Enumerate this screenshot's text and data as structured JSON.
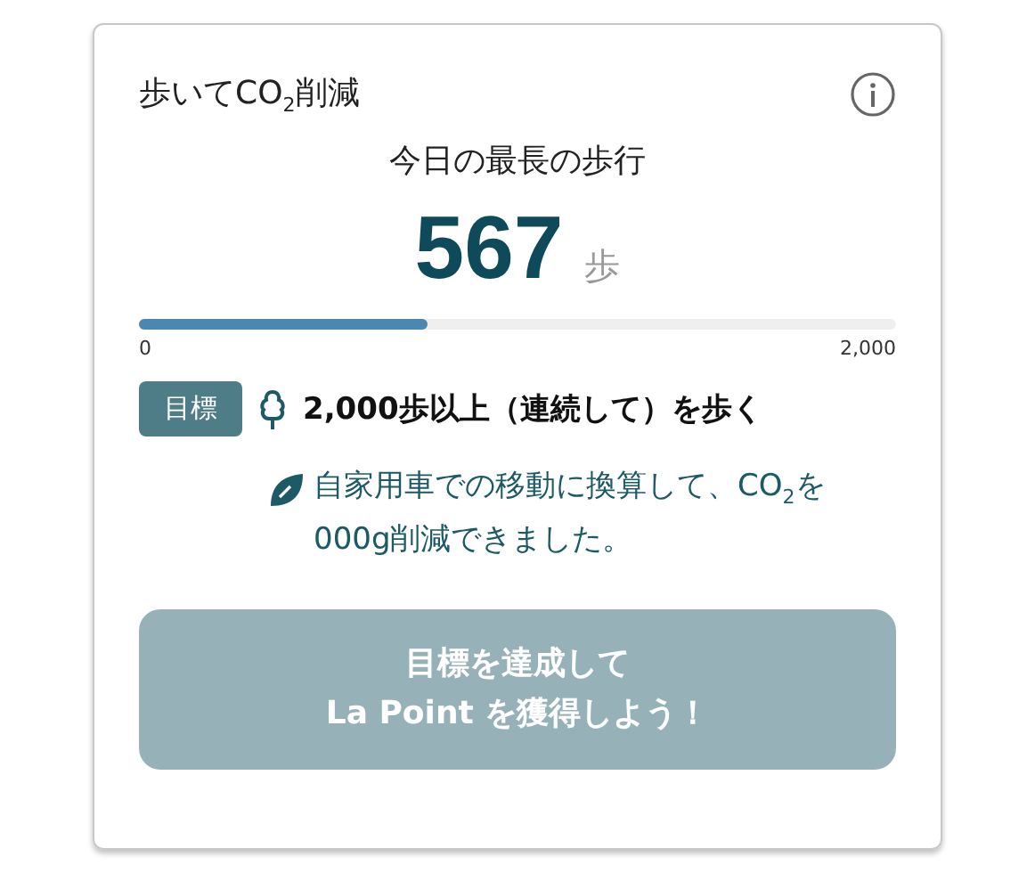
{
  "card": {
    "title": "歩いてCO$_{2}$削減",
    "subtitle": "今日の最長の歩行",
    "steps": {
      "value": "567",
      "unit": "歩"
    },
    "progress": {
      "level": 0.38,
      "min_label": "0",
      "max_label": "2,000"
    },
    "goal": {
      "badge": "目標",
      "text": "2,000歩以上（連続して）を歩く"
    },
    "message": "自家用車での移動に換算して、CO$_{2}$を000g削減できました。",
    "button": {
      "label": "目標を達成して\nLa Point を獲得しよう！",
      "disabled": true
    }
  }
}
